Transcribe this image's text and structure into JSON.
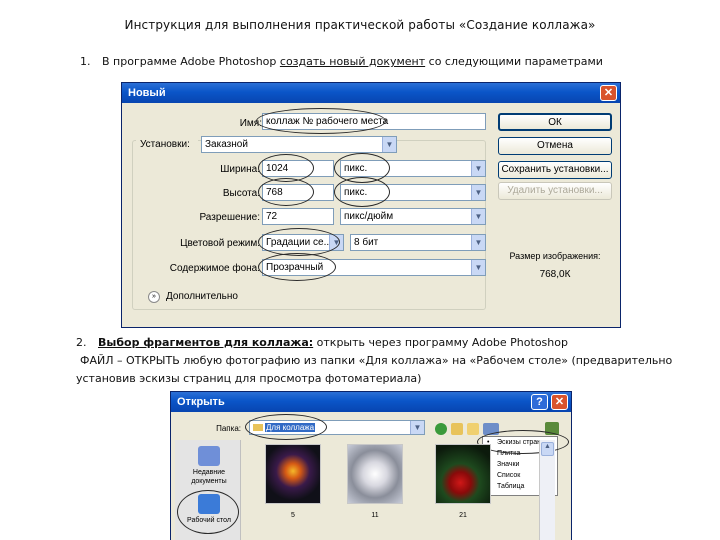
{
  "document": {
    "title": "Инструкция для выполнения практической работы «Создание коллажа»",
    "step1": {
      "number": "1.",
      "before": "В программе Adobe Photoshop ",
      "link": "создать новый документ",
      "after": " со следующими параметрами"
    },
    "step2": {
      "number": "2.",
      "heading": "Выбор фрагментов для коллажа:",
      "after": " открыть через программу Adobe Photoshop",
      "line2": "ФАЙЛ – ОТКРЫТЬ любую фотографию из папки «Для коллажа» на «Рабочем столе» (предварительно",
      "line3": "установив эскизы страниц для просмотра фотоматериала)"
    }
  },
  "new_dialog": {
    "title": "Новый",
    "close": "✕",
    "name_label": "Имя:",
    "name_value": "коллаж № рабочего места",
    "preset_label": "Установки:",
    "preset_value": "Заказной",
    "width_label": "Ширина:",
    "width_value": "1024",
    "width_unit": "пикс.",
    "height_label": "Высота:",
    "height_value": "768",
    "height_unit": "пикс.",
    "resolution_label": "Разрешение:",
    "resolution_value": "72",
    "resolution_unit": "пикс/дюйм",
    "color_mode_label": "Цветовой режим:",
    "color_mode_value": "Градации се...",
    "bit_depth_value": "8 бит",
    "background_label": "Содержимое фона:",
    "background_value": "Прозрачный",
    "advanced_label": "Дополнительно",
    "ok": "ОК",
    "cancel": "Отмена",
    "save_preset": "Сохранить установки...",
    "delete_preset": "Удалить установки...",
    "image_size_label": "Размер изображения:",
    "image_size_value": "768,0К"
  },
  "open_dialog": {
    "title": "Открыть",
    "help": "?",
    "close": "✕",
    "folder_label": "Папка:",
    "folder_value": "Для коллажа",
    "places": [
      {
        "label": "Недавние документы",
        "color": "#6f8fd8"
      },
      {
        "label": "Рабочий стол",
        "color": "#3b7bd8"
      }
    ],
    "thumbnails": [
      {
        "caption": "5"
      },
      {
        "caption": "11"
      },
      {
        "caption": "21"
      }
    ],
    "view_menu": [
      "Эскизы страниц",
      "Плитка",
      "Значки",
      "Список",
      "Таблица"
    ],
    "view_menu_selected": 0
  }
}
